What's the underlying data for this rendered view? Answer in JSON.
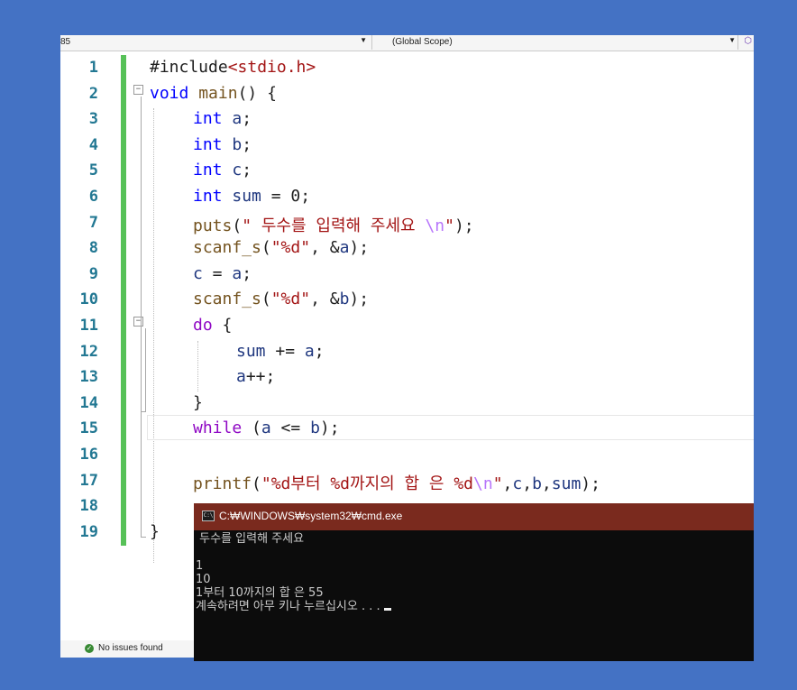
{
  "navbar": {
    "left_fragment": "85",
    "scope": "(Global Scope)"
  },
  "editor": {
    "line_numbers": [
      "1",
      "2",
      "3",
      "4",
      "5",
      "6",
      "7",
      "8",
      "9",
      "10",
      "11",
      "12",
      "13",
      "14",
      "15",
      "16",
      "17",
      "18",
      "19"
    ],
    "code": {
      "l1_directive": "#include",
      "l1_header": "<stdio.h>",
      "l2_kw": "void",
      "l2_fn": "main",
      "l2_rest": "() {",
      "l3_kw": "int",
      "l3_var": "a",
      "l3_end": ";",
      "l4_kw": "int",
      "l4_var": "b",
      "l4_end": ";",
      "l5_kw": "int",
      "l5_var": "c",
      "l5_end": ";",
      "l6_kw": "int",
      "l6_var": "sum",
      "l6_rest": " = 0;",
      "l7_fn": "puts",
      "l7_open": "(",
      "l7_str": "\" 두수를 입력해 주세요 ",
      "l7_esc": "\\n",
      "l7_strend": "\"",
      "l7_close": ");",
      "l8_fn": "scanf_s",
      "l8_open": "(",
      "l8_str": "\"%d\"",
      "l8_mid": ", &",
      "l8_var": "a",
      "l8_close": ");",
      "l9_var1": "c",
      "l9_mid": " = ",
      "l9_var2": "a",
      "l9_end": ";",
      "l10_fn": "scanf_s",
      "l10_open": "(",
      "l10_str": "\"%d\"",
      "l10_mid": ", &",
      "l10_var": "b",
      "l10_close": ");",
      "l11_kw": "do",
      "l11_rest": " {",
      "l12_var1": "sum",
      "l12_mid": " += ",
      "l12_var2": "a",
      "l12_end": ";",
      "l13_var": "a",
      "l13_end": "++;",
      "l14": "}",
      "l15_kw": "while",
      "l15_open": " (",
      "l15_var1": "a",
      "l15_mid": " <= ",
      "l15_var2": "b",
      "l15_close": ");",
      "l17_fn": "printf",
      "l17_open": "(",
      "l17_str": "\"%d부터 %d까지의 합 은 %d",
      "l17_esc": "\\n",
      "l17_strend": "\"",
      "l17_sep1": ",",
      "l17_v1": "c",
      "l17_sep2": ",",
      "l17_v2": "b",
      "l17_sep3": ",",
      "l17_v3": "sum",
      "l17_close": ");",
      "l19": "}"
    }
  },
  "status": {
    "text": "No issues found"
  },
  "console": {
    "title": "C:₩WINDOWS₩system32₩cmd.exe",
    "line1": " 두수를 입력해 주세요",
    "line2": "",
    "line3": "1",
    "line4": "10",
    "line5": "1부터 10까지의 합 은 55",
    "line6": "계속하려면 아무 키나 누르십시오 . . ."
  },
  "colors": {
    "background": "#4472c4",
    "keyword": "#0000ff",
    "control": "#8f08c4",
    "string": "#a31515",
    "function": "#74531f",
    "variable": "#1f377f",
    "line_number": "#237893",
    "change_bar": "#57c158",
    "console_title": "#7a2a1e"
  }
}
